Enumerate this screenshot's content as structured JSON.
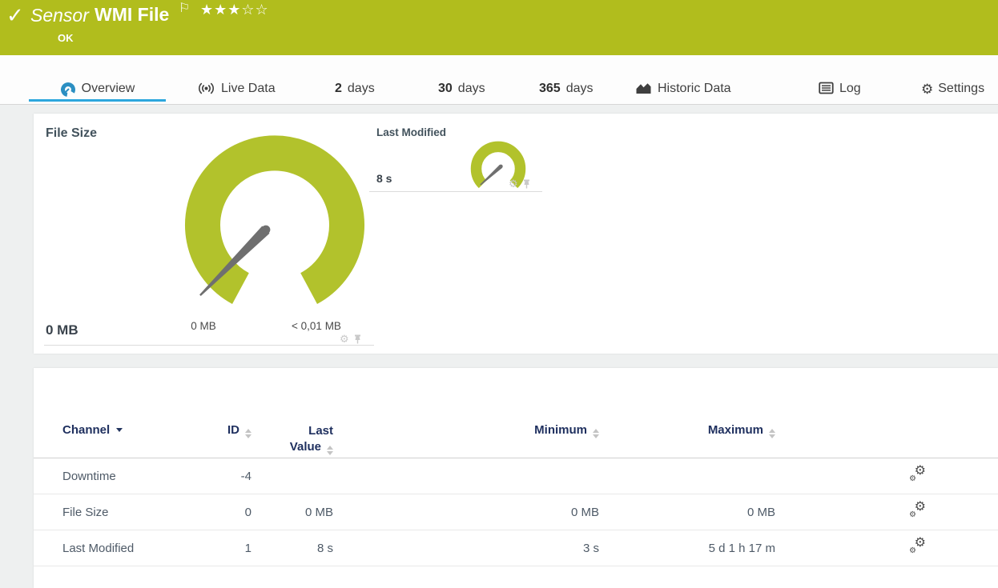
{
  "header": {
    "sensor_label": "Sensor",
    "title": "WMI File",
    "status": "OK",
    "rating_filled": "★★★",
    "rating_empty": "☆☆"
  },
  "tabs": {
    "overview": "Overview",
    "live_data": "Live Data",
    "d2_num": "2",
    "d2_unit": "days",
    "d30_num": "30",
    "d30_unit": "days",
    "d365_num": "365",
    "d365_unit": "days",
    "historic": "Historic Data",
    "log": "Log",
    "settings": "Settings"
  },
  "gauges": {
    "file_size": {
      "title": "File Size",
      "value": "0 MB",
      "min": "0 MB",
      "max": "< 0,01 MB"
    },
    "last_modified": {
      "title": "Last Modified",
      "value": "8 s"
    }
  },
  "table": {
    "headers": {
      "channel": "Channel",
      "id": "ID",
      "last_value": "Last Value",
      "minimum": "Minimum",
      "maximum": "Maximum"
    },
    "rows": [
      {
        "channel": "Downtime",
        "id": "-4",
        "last_value": "",
        "minimum": "",
        "maximum": ""
      },
      {
        "channel": "File Size",
        "id": "0",
        "last_value": "0 MB",
        "minimum": "0 MB",
        "maximum": "0 MB"
      },
      {
        "channel": "Last Modified",
        "id": "1",
        "last_value": "8 s",
        "minimum": "3 s",
        "maximum": "5 d 1 h 17 m"
      }
    ]
  },
  "icons": {
    "gear": "⚙",
    "check": "✓",
    "flag": "⚐"
  },
  "colors": {
    "header_green": "#b1bd1d",
    "gauge_green": "#b2c22c",
    "active_tab_blue": "#2da7dd",
    "table_header_navy": "#1e2f5e"
  }
}
